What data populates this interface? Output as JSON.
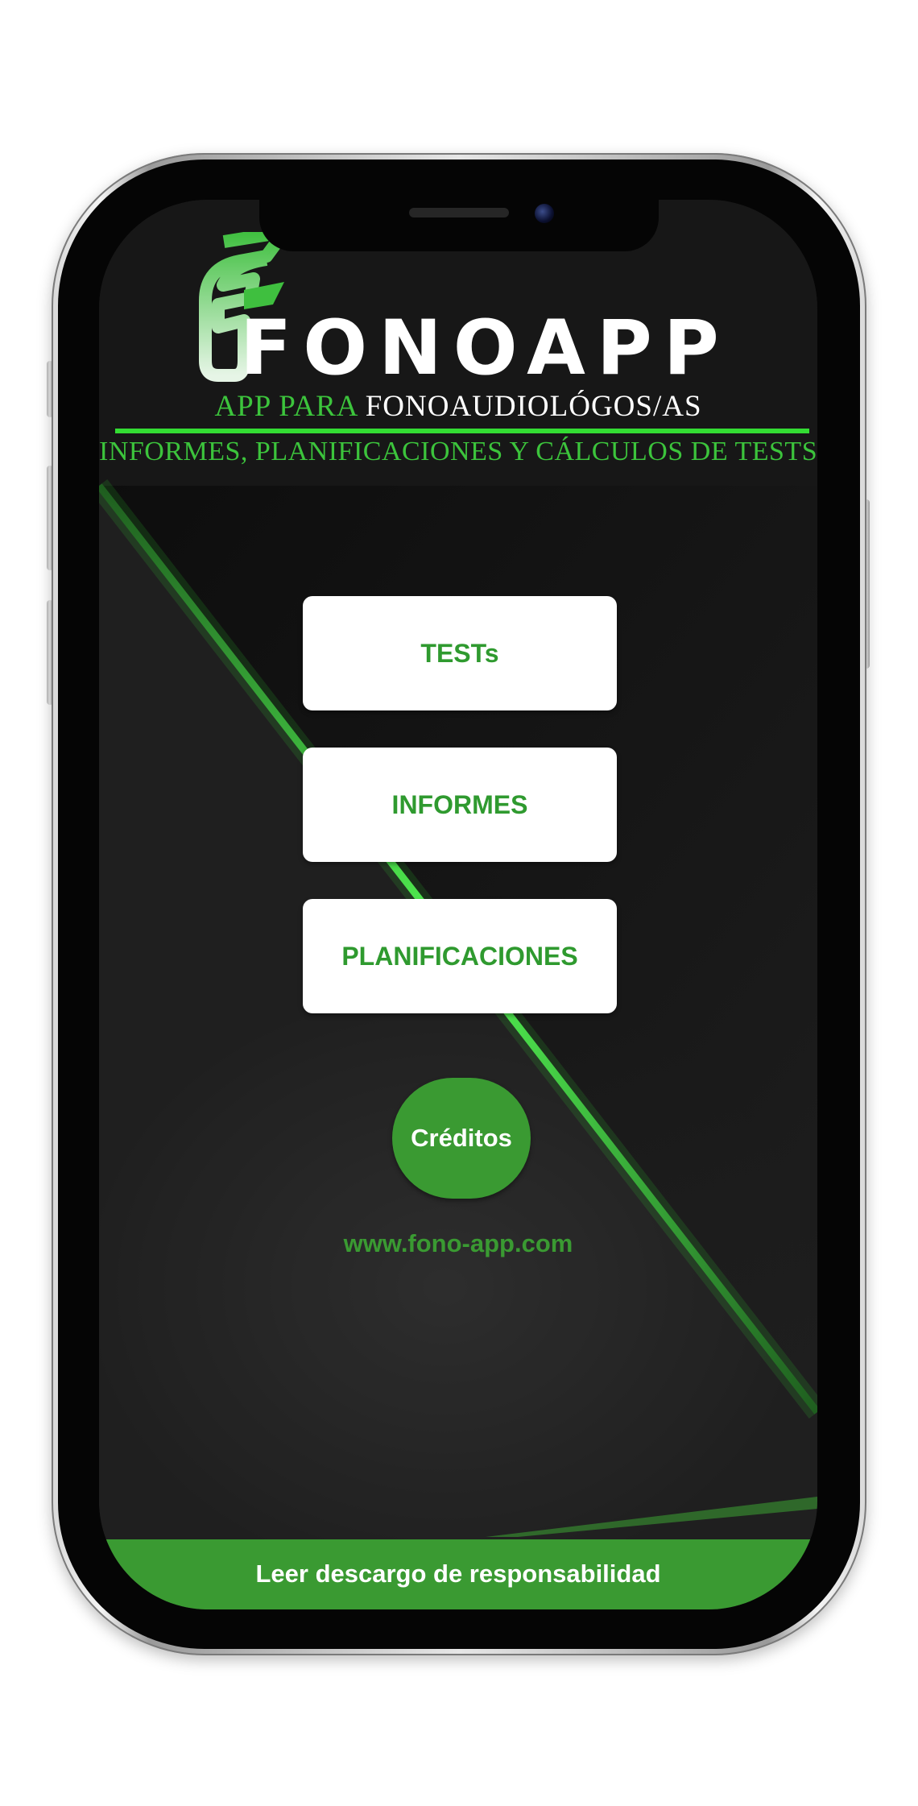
{
  "app": {
    "logo_text": "FONOAPP",
    "tagline_green": "APP PARA",
    "tagline_white": "FONOAUDIOLÓGOS/AS",
    "subtitle": "INFORMES, PLANIFICACIONES Y CÁLCULOS DE TESTS"
  },
  "menu": {
    "tests_label": "TESTs",
    "informes_label": "INFORMES",
    "planificaciones_label": "PLANIFICACIONES"
  },
  "credits_label": "Créditos",
  "website": "www.fono-app.com",
  "disclaimer_label": "Leer descargo de responsabilidad",
  "colors": {
    "accent_green": "#3a9a32",
    "bright_green": "#33dd33",
    "screen_background": "#171717",
    "button_background": "#ffffff"
  }
}
